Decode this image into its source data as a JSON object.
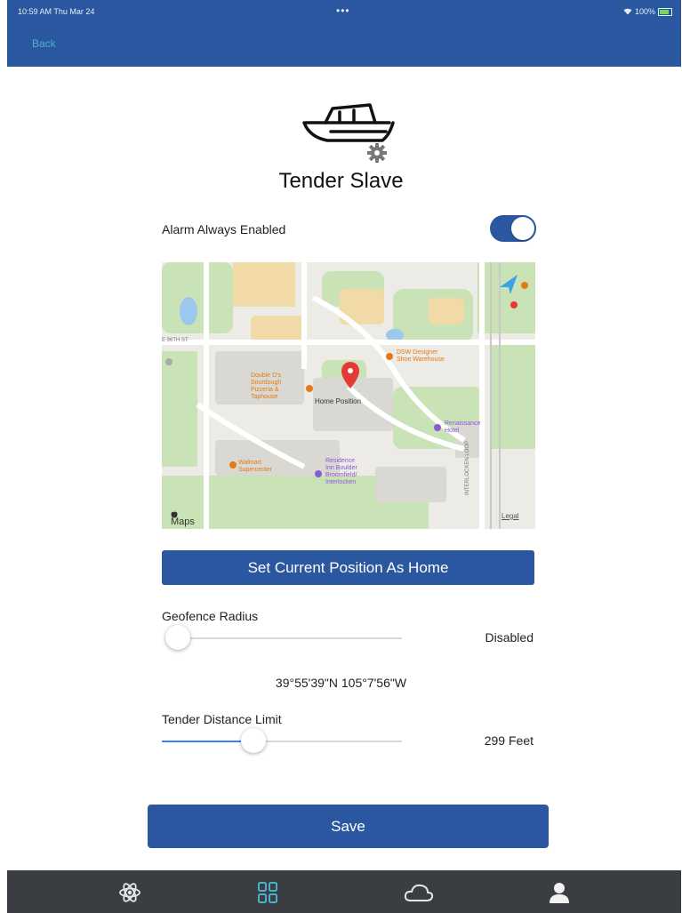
{
  "status_bar": {
    "time": "10:59 AM  Thu Mar 24",
    "dots": "•••",
    "battery": "100%"
  },
  "header": {
    "back_label": "Back"
  },
  "device": {
    "title": "Tender Slave",
    "icon": "boat-settings-icon"
  },
  "alarm": {
    "label": "Alarm Always Enabled",
    "enabled": true
  },
  "map": {
    "pin_label": "Home Position",
    "attribution": "Maps",
    "legal": "Legal",
    "pois": [
      {
        "name": "Double D's Sourdough Pizzeria & Taphouse",
        "lines": [
          "Double D's",
          "Sourdough",
          "Pizzeria &",
          "Taphouse"
        ]
      },
      {
        "name": "DSW Designer Shoe Warehouse",
        "lines": [
          "DSW Designer",
          "Shoe Warehouse"
        ]
      },
      {
        "name": "Renaissance Hotel",
        "lines": [
          "Renaissance",
          "Hotel"
        ]
      },
      {
        "name": "Walmart Supercenter",
        "lines": [
          "Walmart",
          "Supercenter"
        ]
      },
      {
        "name": "Residence Inn Boulder Broomfield/ Interlocken",
        "lines": [
          "Residence",
          "Inn Boulder",
          "Broomfield/",
          "Interlocken"
        ]
      }
    ],
    "streets": [
      "E 96TH ST",
      "INTERLOCKEN LOOP"
    ]
  },
  "set_home_button": "Set Current Position As Home",
  "geofence": {
    "label": "Geofence Radius",
    "value_text": "Disabled",
    "level": 0.0
  },
  "coordinates": "39°55'39\"N  105°7'56\"W",
  "tender_limit": {
    "label": "Tender Distance Limit",
    "value_text": "299 Feet",
    "level": 0.38
  },
  "save_button": "Save",
  "tabbar": {
    "tabs": [
      {
        "icon": "atom-icon",
        "active": false
      },
      {
        "icon": "grid-icon",
        "active": true
      },
      {
        "icon": "cloud-icon",
        "active": false
      },
      {
        "icon": "user-icon",
        "active": false
      }
    ]
  },
  "colors": {
    "primary": "#2a57a0",
    "accent": "#4ab1c8",
    "slider_fill": "#3b82f6",
    "tabbar": "#3a3d42",
    "active_tab": "#4ab1c8"
  }
}
